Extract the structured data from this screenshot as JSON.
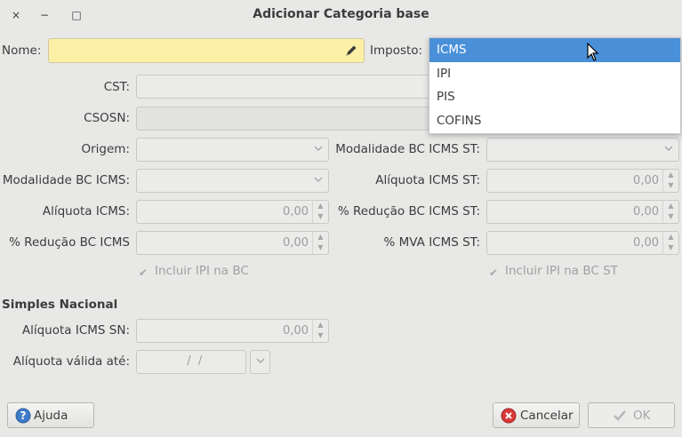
{
  "window": {
    "title": "Adicionar Categoria base",
    "close_glyph": "×",
    "minimize_glyph": "−",
    "maximize_glyph": "□"
  },
  "form": {
    "nome_label": "Nome:",
    "nome_value": "",
    "imposto_label": "Imposto:",
    "imposto_selected": "ICMS",
    "cst_label": "CST:",
    "csosn_label": "CSOSN:",
    "origem_label": "Origem:",
    "modalidade_bc_icms_st_label": "Modalidade BC ICMS ST:",
    "modalidade_bc_icms_label": "Modalidade BC ICMS:",
    "aliquota_icms_st_label": "Alíquota ICMS ST:",
    "aliquota_icms_st_value": "0,00",
    "aliquota_icms_label": "Alíquota ICMS:",
    "aliquota_icms_value": "0,00",
    "reducao_bc_icms_st_label": "% Redução BC ICMS ST:",
    "reducao_bc_icms_st_value": "0,00",
    "reducao_bc_icms_label": "% Redução BC ICMS",
    "reducao_bc_icms_value": "0,00",
    "mva_icms_st_label": "% MVA ICMS ST:",
    "mva_icms_st_value": "0,00",
    "incluir_ipi_bc_label": "Incluir IPI na BC",
    "incluir_ipi_bc_st_label": "Incluir IPI na BC ST"
  },
  "simples": {
    "section_title": "Simples Nacional",
    "aliquota_icms_sn_label": "Alíquota ICMS SN:",
    "aliquota_icms_sn_value": "0,00",
    "aliquota_valida_label": "Alíquota válida até:",
    "aliquota_valida_value": "  /  /"
  },
  "imposto_dropdown": {
    "options": [
      "ICMS",
      "IPI",
      "PIS",
      "COFINS"
    ],
    "selected_index": 0
  },
  "buttons": {
    "ajuda": "Ajuda",
    "cancelar": "Cancelar",
    "ok": "OK"
  },
  "colors": {
    "selection": "#4a90d9",
    "required_field": "#fbf0a6",
    "window_bg": "#e8e8e7"
  }
}
